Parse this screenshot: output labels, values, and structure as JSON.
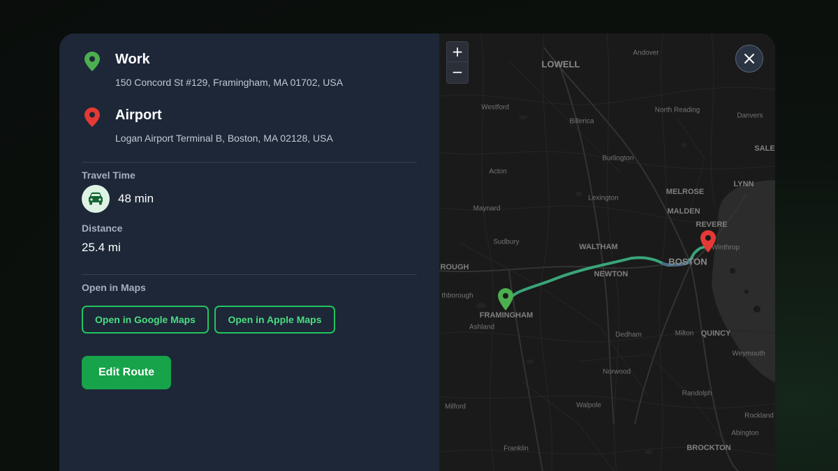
{
  "origin": {
    "name": "Work",
    "address": "150 Concord St #129, Framingham, MA 01702, USA",
    "pin_color": "#4caf50"
  },
  "destination": {
    "name": "Airport",
    "address": "Logan Airport Terminal B, Boston, MA 02128, USA",
    "pin_color": "#e53935"
  },
  "travel": {
    "label": "Travel Time",
    "icon": "car-icon",
    "value": "48 min"
  },
  "distance": {
    "label": "Distance",
    "value": "25.4 mi"
  },
  "open_in_maps": {
    "label": "Open in Maps",
    "google_label": "Open in Google Maps",
    "apple_label": "Open in Apple Maps"
  },
  "edit_route_label": "Edit Route",
  "accent_color": "#22c55e",
  "map": {
    "zoom_in_label": "+",
    "zoom_out_label": "−",
    "close_icon": "close-icon",
    "places": [
      "LOWELL",
      "Andover",
      "Westford",
      "North Reading",
      "Danvers",
      "Billerica",
      "SALE",
      "Burlington",
      "Acton",
      "LYNN",
      "MELROSE",
      "Lexington",
      "MALDEN",
      "Maynard",
      "REVERE",
      "Sudbury",
      "WALTHAM",
      "Winthrop",
      "BOSTON",
      "ROUGH",
      "NEWTON",
      "thborough",
      "FRAMINGHAM",
      "Ashland",
      "Dedham",
      "Milton",
      "QUINCY",
      "Weymouth",
      "Norwood",
      "Randolph",
      "Milford",
      "Walpole",
      "Rockland",
      "Abington",
      "Franklin",
      "BROCKTON"
    ]
  }
}
